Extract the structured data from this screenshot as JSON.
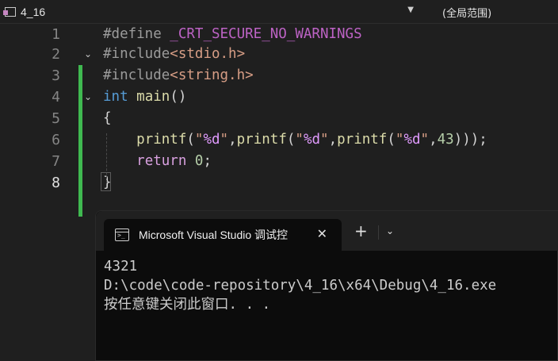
{
  "navbar": {
    "file_label": "4_16",
    "scope_label": "(全局范围)"
  },
  "editor": {
    "line_numbers": [
      "1",
      "2",
      "3",
      "4",
      "5",
      "6",
      "7",
      "8"
    ],
    "active_line": "8",
    "lines": [
      {
        "tokens": [
          {
            "t": "#define ",
            "k": "pp"
          },
          {
            "t": "_CRT_SECURE_NO_WARNINGS",
            "k": "macro"
          }
        ]
      },
      {
        "tokens": [
          {
            "t": "#include",
            "k": "pp"
          },
          {
            "t": "<stdio.h>",
            "k": "str"
          }
        ]
      },
      {
        "tokens": [
          {
            "t": "#include",
            "k": "pp"
          },
          {
            "t": "<string.h>",
            "k": "str"
          }
        ]
      },
      {
        "tokens": [
          {
            "t": "int",
            "k": "kw"
          },
          {
            "t": " ",
            "k": "punc"
          },
          {
            "t": "main",
            "k": "fn"
          },
          {
            "t": "()",
            "k": "punc"
          }
        ]
      },
      {
        "tokens": [
          {
            "t": "{",
            "k": "punc"
          }
        ]
      },
      {
        "tokens": [
          {
            "t": "    ",
            "k": "punc"
          },
          {
            "t": "printf",
            "k": "fn"
          },
          {
            "t": "(",
            "k": "punc"
          },
          {
            "t": "\"",
            "k": "str"
          },
          {
            "t": "%d",
            "k": "fmt"
          },
          {
            "t": "\"",
            "k": "str"
          },
          {
            "t": ",",
            "k": "punc"
          },
          {
            "t": "printf",
            "k": "fn"
          },
          {
            "t": "(",
            "k": "punc"
          },
          {
            "t": "\"",
            "k": "str"
          },
          {
            "t": "%d",
            "k": "fmt"
          },
          {
            "t": "\"",
            "k": "str"
          },
          {
            "t": ",",
            "k": "punc"
          },
          {
            "t": "printf",
            "k": "fn"
          },
          {
            "t": "(",
            "k": "punc"
          },
          {
            "t": "\"",
            "k": "str"
          },
          {
            "t": "%d",
            "k": "fmt"
          },
          {
            "t": "\"",
            "k": "str"
          },
          {
            "t": ",",
            "k": "punc"
          },
          {
            "t": "43",
            "k": "num"
          },
          {
            "t": ")));",
            "k": "punc"
          }
        ]
      },
      {
        "tokens": [
          {
            "t": "    ",
            "k": "punc"
          },
          {
            "t": "return",
            "k": "ctrl"
          },
          {
            "t": " ",
            "k": "punc"
          },
          {
            "t": "0",
            "k": "num"
          },
          {
            "t": ";",
            "k": "punc"
          }
        ]
      },
      {
        "tokens": [
          {
            "t": "}",
            "k": "punc"
          }
        ]
      }
    ]
  },
  "terminal": {
    "tab_title": "Microsoft Visual Studio 调试控",
    "close_symbol": "✕",
    "new_tab_symbol": "+",
    "dropdown_symbol": "⌄",
    "output": [
      "4321",
      "D:\\code\\code-repository\\4_16\\x64\\Debug\\4_16.exe",
      "按任意键关闭此窗口. . ."
    ]
  },
  "colors": {
    "editor_bg": "#1f1f1f",
    "change_bar": "#3fb950",
    "terminal_bg": "#0c0c0c",
    "preprocessor": "#9b9b9b",
    "macro": "#bd63c5",
    "keyword": "#569cd6",
    "control_keyword": "#d8a0df",
    "function": "#dcdcaa",
    "string": "#d69d85",
    "format_spec": "#e19bff",
    "number": "#b5cea8"
  },
  "icons": {
    "navbar_file": "cpp-file-icon",
    "terminal_tab": "console-window-icon"
  }
}
